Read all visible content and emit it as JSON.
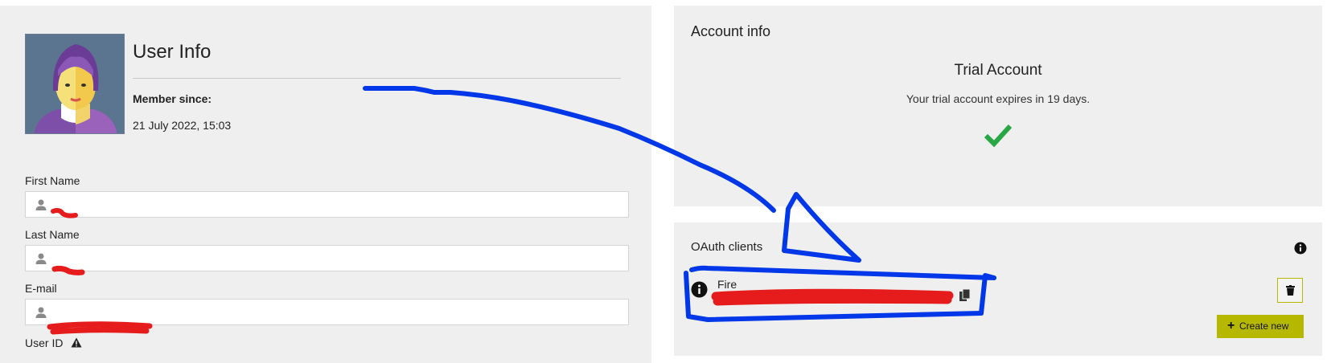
{
  "user_info": {
    "title": "User Info",
    "member_since_label": "Member since:",
    "member_since_value": "21 July 2022, 15:03",
    "fields": [
      {
        "label": "First Name",
        "value": ""
      },
      {
        "label": "Last Name",
        "value": ""
      },
      {
        "label": "E-mail",
        "value": ""
      }
    ],
    "user_id_label": "User ID"
  },
  "account_info": {
    "title": "Account info",
    "plan_title": "Trial Account",
    "plan_text": "Your trial account expires in 19 days."
  },
  "oauth": {
    "title": "OAuth clients",
    "client_name": "Fire",
    "create_label": "Create new"
  },
  "colors": {
    "panel_bg": "#efefef",
    "accent": "#b6b800",
    "check_green": "#28a745",
    "annotation_blue": "#0037e8",
    "redaction_red": "#e61c1c"
  }
}
